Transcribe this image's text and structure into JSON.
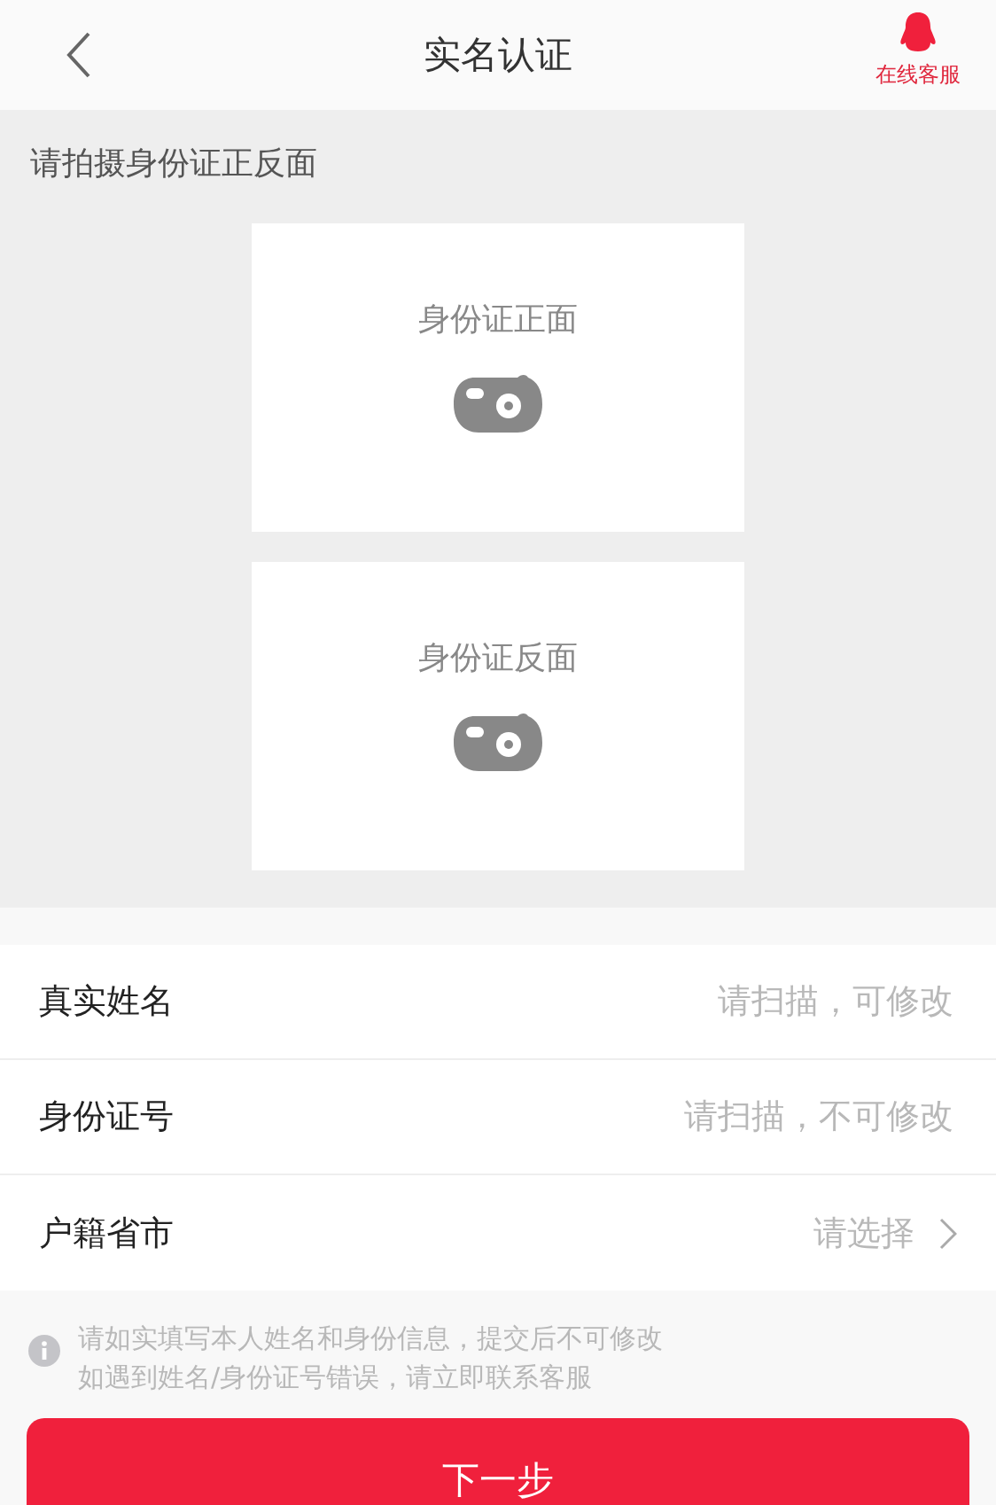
{
  "header": {
    "title": "实名认证",
    "service_label": "在线客服"
  },
  "photo_section": {
    "label": "请拍摄身份证正反面",
    "cards": [
      {
        "label": "身份证正面"
      },
      {
        "label": "身份证反面"
      }
    ]
  },
  "form": [
    {
      "kind": "input",
      "label": "真实姓名",
      "placeholder": "请扫描，可修改"
    },
    {
      "kind": "input",
      "label": "身份证号",
      "placeholder": "请扫描，不可修改"
    },
    {
      "kind": "select",
      "label": "户籍省市",
      "placeholder": "请选择"
    }
  ],
  "notice": {
    "lines": [
      "请如实填写本人姓名和身份信息，提交后不可修改",
      "如遇到姓名/身份证号错误，请立即联系客服"
    ]
  },
  "submit": "下一步"
}
